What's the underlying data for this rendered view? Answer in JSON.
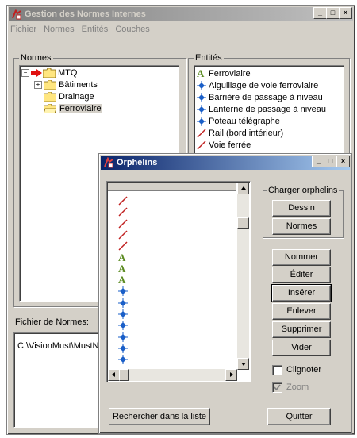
{
  "main_window": {
    "title": "Gestion des Normes Internes",
    "menu": [
      "Fichier",
      "Normes",
      "Entités",
      "Couches"
    ],
    "normes_label": "Normes",
    "tree": [
      {
        "label": "MTQ",
        "level": 0,
        "expander": "−",
        "selected": false
      },
      {
        "label": "Bâtiments",
        "level": 1,
        "expander": "+",
        "selected": false
      },
      {
        "label": "Drainage",
        "level": 1,
        "expander": "",
        "selected": false
      },
      {
        "label": "Ferroviaire",
        "level": 1,
        "expander": "",
        "selected": true
      }
    ],
    "entites_label": "Entités",
    "entites": [
      {
        "label": "Ferroviaire",
        "icon": "letter-a-icon"
      },
      {
        "label": "Aiguillage de voie ferroviaire",
        "icon": "point-symbol-icon"
      },
      {
        "label": "Barrière de passage à niveau",
        "icon": "point-symbol-icon"
      },
      {
        "label": "Lanterne de passage à niveau",
        "icon": "point-symbol-icon"
      },
      {
        "label": "Poteau télégraphe",
        "icon": "point-symbol-icon"
      },
      {
        "label": "Rail (bord intérieur)",
        "icon": "line-symbol-icon"
      },
      {
        "label": "Voie ferrée",
        "icon": "line-symbol-icon"
      }
    ],
    "fichier_label": "Fichier de Normes:",
    "fichier_path": "C:\\VisionMust\\MustN"
  },
  "orphelins": {
    "title": "Orphelins",
    "list_icons": [
      "line-symbol-icon",
      "line-symbol-icon",
      "line-symbol-icon",
      "line-symbol-icon",
      "line-symbol-icon",
      "letter-a-icon",
      "letter-a-icon",
      "letter-a-icon",
      "point-symbol-icon",
      "point-symbol-icon",
      "point-symbol-icon",
      "point-symbol-icon",
      "point-symbol-icon",
      "point-symbol-icon",
      "point-symbol-icon"
    ],
    "charger_label": "Charger orphelins",
    "btn_dessin": "Dessin",
    "btn_normes": "Normes",
    "btn_nommer": "Nommer",
    "btn_editer": "Éditer",
    "btn_inserer": "Insérer",
    "btn_enlever": "Enlever",
    "btn_supprimer": "Supprimer",
    "btn_vider": "Vider",
    "clignoter_label": "Clignoter",
    "clignoter_checked": false,
    "zoom_label": "Zoom",
    "zoom_checked": true,
    "btn_rechercher": "Rechercher dans la liste",
    "btn_quitter": "Quitter"
  },
  "colors": {
    "title_active": "#0a246a",
    "selection_arrow": "#e01010",
    "symbol_blue": "#1a5fc8",
    "symbol_red": "#c02020",
    "symbol_green": "#5a8a20"
  }
}
